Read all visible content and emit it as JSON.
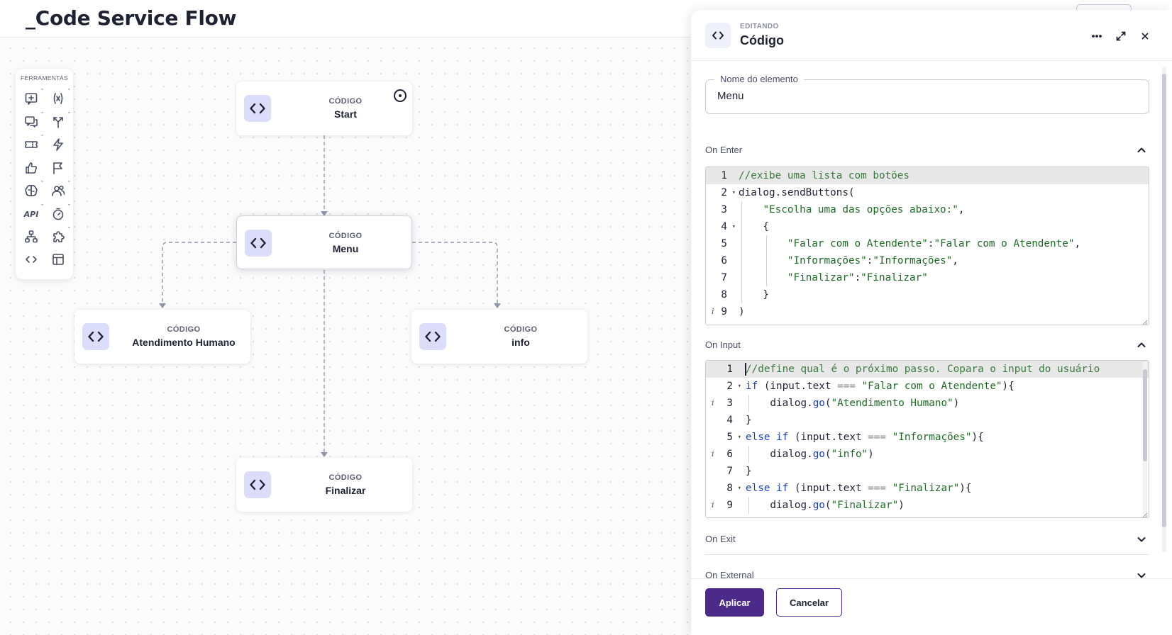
{
  "header": {
    "title": "_Code Service Flow"
  },
  "colors": {
    "accent": "#4b2a8a",
    "node_icon_bg": "#dcdcfb",
    "edge": "#8f96a8"
  },
  "toolbox": {
    "title": "FERRAMENTAS",
    "tools": [
      {
        "icon": "add-message-icon",
        "has_menu": true
      },
      {
        "icon": "variable-icon",
        "has_menu": true
      },
      {
        "icon": "chat-bubbles-icon",
        "has_menu": true
      },
      {
        "icon": "branch-icon",
        "has_menu": true
      },
      {
        "icon": "ticket-icon",
        "has_menu": true
      },
      {
        "icon": "lightning-icon",
        "has_menu": false
      },
      {
        "icon": "thumbs-up-icon",
        "has_menu": false
      },
      {
        "icon": "flag-icon",
        "has_menu": false
      },
      {
        "icon": "brain-icon",
        "has_menu": true
      },
      {
        "icon": "users-icon",
        "has_menu": true
      },
      {
        "icon": "api-icon",
        "label": "API",
        "has_menu": true
      },
      {
        "icon": "timer-icon",
        "has_menu": true
      },
      {
        "icon": "hierarchy-icon",
        "has_menu": false
      },
      {
        "icon": "puzzle-icon",
        "has_menu": true
      },
      {
        "icon": "code-icon",
        "has_menu": false
      },
      {
        "icon": "table-icon",
        "has_menu": false
      }
    ]
  },
  "nodes": {
    "start": {
      "type": "CÓDIGO",
      "label": "Start"
    },
    "menu": {
      "type": "CÓDIGO",
      "label": "Menu"
    },
    "atendimento": {
      "type": "CÓDIGO",
      "label": "Atendimento Humano"
    },
    "info": {
      "type": "CÓDIGO",
      "label": "info"
    },
    "finalizar": {
      "type": "CÓDIGO",
      "label": "Finalizar"
    }
  },
  "panel": {
    "kicker": "EDITANDO",
    "title": "Código",
    "field": {
      "legend": "Nome do elemento",
      "value": "Menu"
    },
    "sections": {
      "on_enter": "On Enter",
      "on_input": "On Input",
      "on_exit": "On Exit",
      "on_external": "On External"
    },
    "on_enter_code": [
      {
        "n": "1",
        "fold": false,
        "info": false,
        "text": "//exibe uma lista com botões"
      },
      {
        "n": "2",
        "fold": true,
        "info": false,
        "text": "dialog.sendButtons("
      },
      {
        "n": "3",
        "fold": false,
        "info": false,
        "text": "    \"Escolha uma das opções abaixo:\","
      },
      {
        "n": "4",
        "fold": true,
        "info": false,
        "text": "    {"
      },
      {
        "n": "5",
        "fold": false,
        "info": false,
        "text": "        \"Falar com o Atendente\":\"Falar com o Atendente\","
      },
      {
        "n": "6",
        "fold": false,
        "info": false,
        "text": "        \"Informações\":\"Informações\","
      },
      {
        "n": "7",
        "fold": false,
        "info": false,
        "text": "        \"Finalizar\":\"Finalizar\""
      },
      {
        "n": "8",
        "fold": false,
        "info": false,
        "text": "    }"
      },
      {
        "n": "9",
        "fold": false,
        "info": true,
        "text": ")"
      }
    ],
    "on_input_code": [
      {
        "n": "1",
        "fold": false,
        "info": false,
        "text": "//define qual é o próximo passo. Copara o input do usuário"
      },
      {
        "n": "2",
        "fold": true,
        "info": false,
        "text": "if (input.text === \"Falar com o Atendente\"){"
      },
      {
        "n": "3",
        "fold": false,
        "info": true,
        "text": "    dialog.go(\"Atendimento Humano\")"
      },
      {
        "n": "4",
        "fold": false,
        "info": false,
        "text": "}"
      },
      {
        "n": "5",
        "fold": true,
        "info": false,
        "text": "else if (input.text === \"Informações\"){"
      },
      {
        "n": "6",
        "fold": false,
        "info": true,
        "text": "    dialog.go(\"info\")"
      },
      {
        "n": "7",
        "fold": false,
        "info": false,
        "text": "}"
      },
      {
        "n": "8",
        "fold": true,
        "info": false,
        "text": "else if (input.text === \"Finalizar\"){"
      },
      {
        "n": "9",
        "fold": false,
        "info": true,
        "text": "    dialog.go(\"Finalizar\")"
      }
    ],
    "apply_label": "Aplicar",
    "cancel_label": "Cancelar"
  }
}
